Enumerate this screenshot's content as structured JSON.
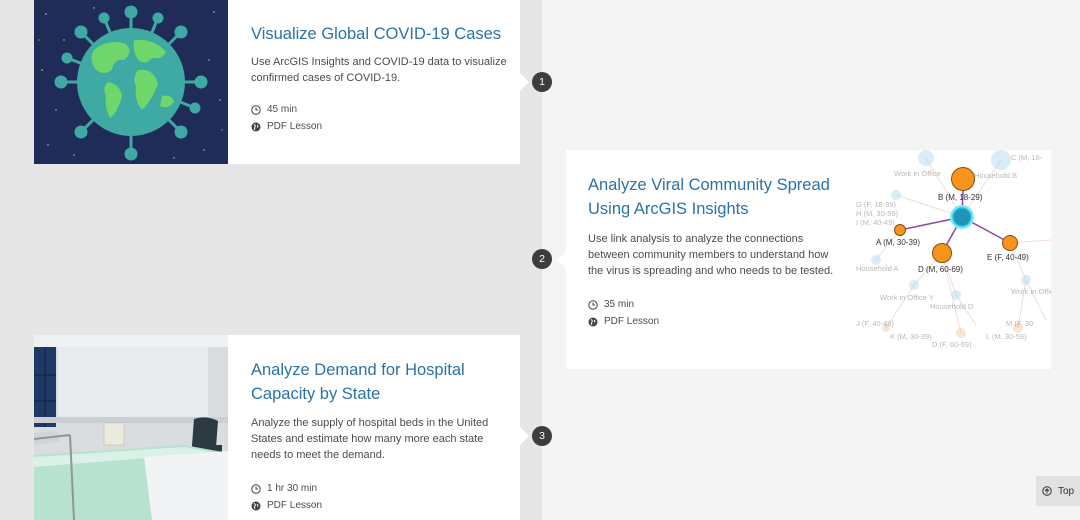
{
  "lessons": [
    {
      "number": "1",
      "title": "Visualize Global COVID-19 Cases",
      "description": "Use ArcGIS Insights and COVID-19 data to visualize confirmed cases of COVID-19.",
      "duration": "45 min",
      "format": "PDF Lesson"
    },
    {
      "number": "2",
      "title": "Analyze Viral Community Spread Using ArcGIS Insights",
      "description": "Use link analysis to analyze the connections between community members to understand how the virus is spreading and who needs to be tested.",
      "duration": "35 min",
      "format": "PDF Lesson",
      "graph_labels": {
        "b": "B (M, 18-29)",
        "a": "A (M, 30-39)",
        "d": "D (M, 60-69)",
        "e": "E (F, 40-49)",
        "work_office": "Work in Office",
        "household_b": "Household B",
        "g": "G (F, 18-39)",
        "h": "H (M, 30-59)",
        "i": "I (M, 40-49)",
        "household_a": "Household A",
        "work_office_y": "Work in Office Y",
        "household_d": "Household D",
        "j": "J (F, 40-49)",
        "k": "K (M, 30-39)",
        "d2": "D (F, 60-69)",
        "l": "L (M, 30-59)",
        "m": "M (F, 30",
        "work_office_2": "Work in Office",
        "c": "C (M, 18-"
      }
    },
    {
      "number": "3",
      "title": "Analyze Demand for Hospital Capacity by State",
      "description": "Analyze the supply of hospital beds in the United States and estimate how many more each state needs to meet the demand.",
      "duration": "1 hr 30 min",
      "format": "PDF Lesson"
    }
  ],
  "top_button": {
    "label": "Top"
  },
  "colors": {
    "title": "#2a72a8",
    "badge": "#3d3d3d",
    "orange": "#f7941e",
    "cyan": "#1fc3e0"
  }
}
